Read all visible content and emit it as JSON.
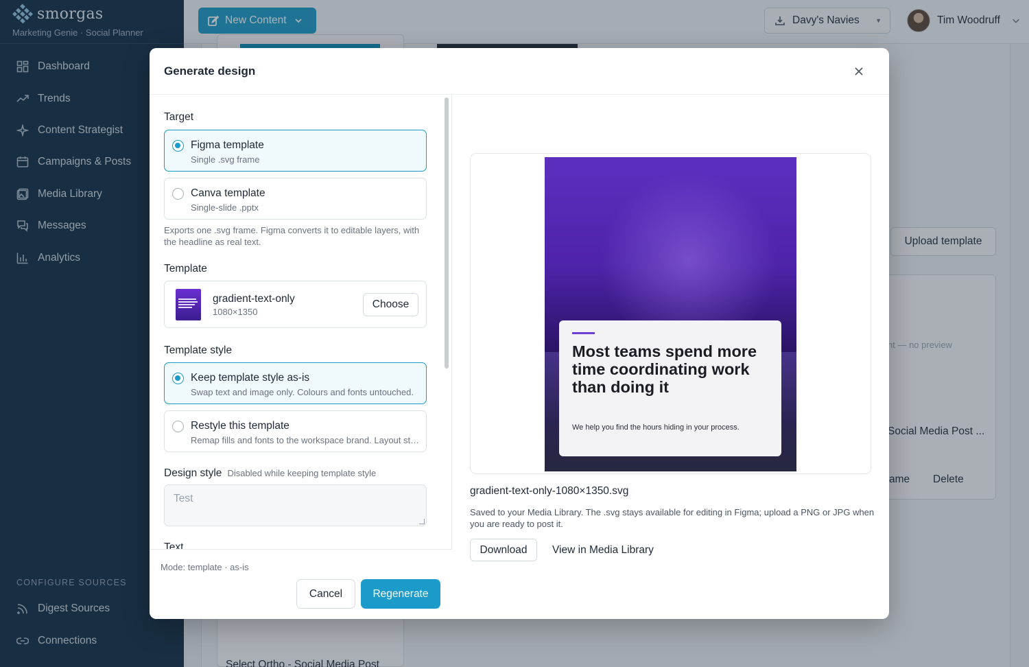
{
  "brand": {
    "name": "smorgas",
    "subtitle": "Marketing Genie · Social Planner"
  },
  "sidebar": {
    "items": [
      {
        "label": "Dashboard",
        "icon": "dashboard-icon"
      },
      {
        "label": "Trends",
        "icon": "trend-icon"
      },
      {
        "label": "Content Strategist",
        "icon": "sparkle-icon"
      },
      {
        "label": "Campaigns & Posts",
        "icon": "calendar-icon"
      },
      {
        "label": "Media Library",
        "icon": "image-icon"
      },
      {
        "label": "Messages",
        "icon": "chat-icon"
      },
      {
        "label": "Analytics",
        "icon": "bar-chart-icon"
      }
    ],
    "config_title": "CONFIGURE SOURCES",
    "config_items": [
      {
        "label": "Digest Sources",
        "icon": "rss-icon"
      },
      {
        "label": "Connections",
        "icon": "link-icon"
      }
    ]
  },
  "topbar": {
    "new_content": "New Content",
    "workspace": "Davy's Navies",
    "user_name": "Tim Woodruff"
  },
  "background": {
    "upload_template": "Upload template",
    "no_preview": "nt — no preview",
    "card_title": "Social Media Post ...",
    "rename": "ame",
    "delete": "Delete",
    "bottom_card": "Select Ortho - Social Media Post"
  },
  "modal": {
    "title": "Generate design",
    "target_label": "Target",
    "targets": [
      {
        "title": "Figma template",
        "sub": "Single .svg frame",
        "selected": true
      },
      {
        "title": "Canva template",
        "sub": "Single-slide .pptx",
        "selected": false
      }
    ],
    "target_help": "Exports one .svg frame. Figma converts it to editable layers, with the headline as real text.",
    "template_label": "Template",
    "template": {
      "name": "gradient-text-only",
      "size": "1080×1350",
      "choose": "Choose"
    },
    "style_label": "Template style",
    "styles": [
      {
        "title": "Keep template style as-is",
        "sub": "Swap text and image only. Colours and fonts untouched.",
        "selected": true
      },
      {
        "title": "Restyle this template",
        "sub": "Remap fills and fonts to the workspace brand. Layout stays.",
        "selected": false
      }
    ],
    "design_style_label": "Design style",
    "design_style_hint": "Disabled while keeping template style",
    "design_style_value": "Test",
    "text_label": "Text",
    "mode": "Mode: template · as-is",
    "cancel": "Cancel",
    "regenerate": "Regenerate",
    "preview": {
      "headline": "Most teams spend more time coordinating work than doing it",
      "subline": "We help you find the hours hiding in your process."
    },
    "file_name": "gradient-text-only-1080×1350.svg",
    "saved_text": "Saved to your Media Library. The .svg stays available for editing in Figma; upload a PNG or JPG when you are ready to post it.",
    "download": "Download",
    "view_library": "View in Media Library"
  },
  "colors": {
    "accent": "#1a9bc9",
    "sidebar": "#0f2a43",
    "poster_purple": "#5d2fbf"
  }
}
